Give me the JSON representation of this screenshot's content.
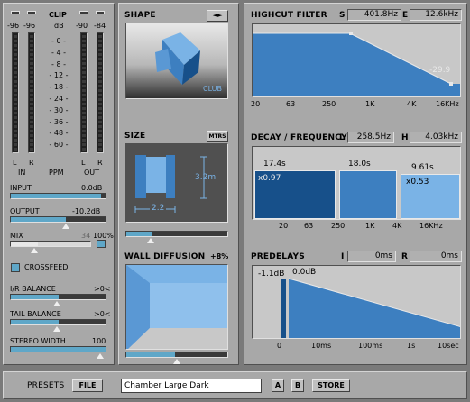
{
  "meters": {
    "peak_labels": [
      "-96",
      "-96",
      "-90",
      "-84"
    ],
    "clip_label": "CLIP",
    "db_label": "dB",
    "scale": [
      "0",
      "4",
      "8",
      "12",
      "18",
      "24",
      "30",
      "36",
      "48",
      "60"
    ],
    "in_l": "L",
    "in_r": "R",
    "in_label": "IN",
    "ppm_label": "PPM",
    "out_l": "L",
    "out_r": "R",
    "out_label": "OUT"
  },
  "controls": {
    "input_label": "INPUT",
    "input_value": "0.0dB",
    "input_level": 0.95,
    "output_label": "OUTPUT",
    "output_value": "-10.2dB",
    "output_level": 0.58,
    "mix_label": "MIX",
    "mix_value": "34",
    "mix_max": "100%",
    "mix_level": 0.34,
    "crossfeed_label": "CROSSFEED",
    "ir_balance_label": "I/R BALANCE",
    "ir_balance_value": ">0<",
    "ir_balance_level": 0.5,
    "tail_balance_label": "TAIL BALANCE",
    "tail_balance_value": ">0<",
    "tail_balance_level": 0.5,
    "stereo_width_label": "STEREO WIDTH",
    "stereo_width_value": "100",
    "stereo_width_level": 1.0
  },
  "shape": {
    "title": "SHAPE",
    "arrows": "◄►",
    "room_name": "CLUB"
  },
  "size": {
    "title": "SIZE",
    "unit_button": "MTRS",
    "height_value": "3.2m",
    "width_value": "2.2",
    "size_level": 0.25
  },
  "wall_diffusion": {
    "title": "WALL DIFFUSION",
    "value": "+8%",
    "level": 0.48
  },
  "highcut": {
    "title": "HIGHCUT FILTER",
    "s_label": "S",
    "s_value": "401.8Hz",
    "e_label": "E",
    "e_value": "12.6kHz",
    "end_value": "-29.9",
    "x_labels": [
      "20",
      "63",
      "250",
      "1K",
      "4K",
      "16KHz"
    ]
  },
  "decay": {
    "title": "DECAY / FREQUENCY",
    "l_label": "L",
    "l_value": "258.5Hz",
    "h_label": "H",
    "h_value": "4.03kHz",
    "low_time": "17.4s",
    "low_mult": "x0.97",
    "mid_time": "18.0s",
    "high_time": "9.61s",
    "high_mult": "x0.53",
    "x_labels": [
      "20",
      "63",
      "250",
      "1K",
      "4K",
      "16KHz"
    ]
  },
  "predelays": {
    "title": "PREDELAYS",
    "i_label": "I",
    "i_value": "0ms",
    "r_label": "R",
    "r_value": "0ms",
    "level1": "-1.1dB",
    "level2": "0.0dB",
    "x_labels": [
      "0",
      "10ms",
      "100ms",
      "1s",
      "10sec"
    ]
  },
  "presets": {
    "label": "PRESETS",
    "file_button": "FILE",
    "preset_name": "Chamber Large Dark",
    "a_button": "A",
    "b_button": "B",
    "store_button": "STORE"
  },
  "colors": {
    "accent": "#5fa7c8",
    "dark_blue": "#17508a",
    "mid_blue": "#3d7fc0",
    "light_blue": "#7ab3e6"
  }
}
